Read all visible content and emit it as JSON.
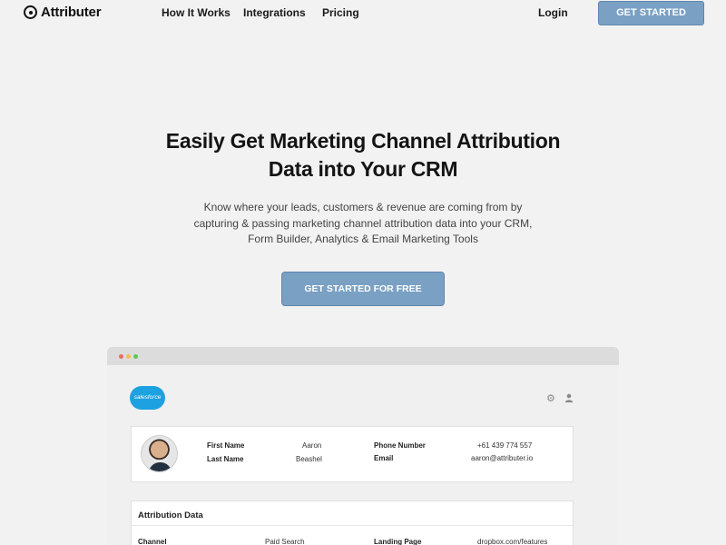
{
  "nav": {
    "logo_text": "Attributer",
    "links": [
      "How It Works",
      "Integrations",
      "Pricing"
    ],
    "login": "Login",
    "cta": "GET STARTED"
  },
  "hero": {
    "title_line1": "Easily Get Marketing Channel Attribution",
    "title_line2": "Data into Your CRM",
    "subtitle_line1": "Know where your leads, customers & revenue are coming from by",
    "subtitle_line2": "capturing & passing marketing channel attribution data into your CRM,",
    "subtitle_line3": "Form Builder, Analytics & Email Marketing Tools",
    "cta": "GET STARTED FOR FREE"
  },
  "mockup": {
    "window_dot_colors": [
      "#ee6b60",
      "#f5be4f",
      "#62c554"
    ],
    "crm_logo": "salesforce",
    "contact": {
      "first_name_label": "First Name",
      "first_name_value": "Aaron",
      "last_name_label": "Last Name",
      "last_name_value": "Beashel",
      "phone_label": "Phone Number",
      "phone_value": "+61 439 774 557",
      "email_label": "Email",
      "email_value": "aaron@attributer.io"
    },
    "attribution": {
      "title": "Attribution Data",
      "channel_label": "Channel",
      "channel_value": "Paid Search",
      "landing_label": "Landing Page",
      "landing_value": "dropbox.com/features"
    }
  },
  "colors": {
    "accent": "#7aa0c4",
    "background": "#f2f2f2",
    "salesforce_blue": "#1da1e0"
  },
  "icons": [
    "logo-mark-icon",
    "gear-icon",
    "user-icon",
    "salesforce-logo"
  ]
}
